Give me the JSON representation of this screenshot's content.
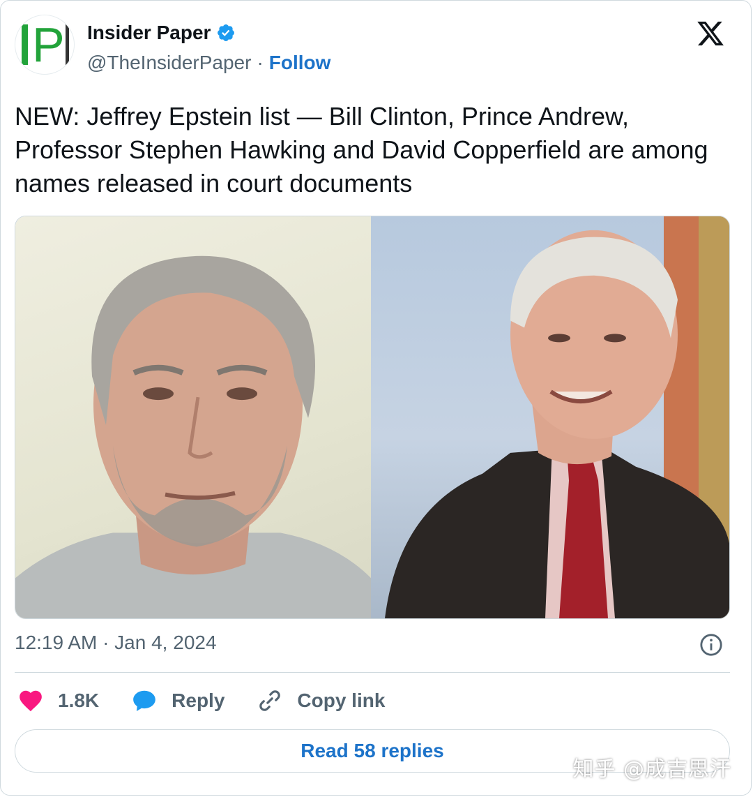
{
  "author": {
    "display_name": "Insider Paper",
    "handle": "@TheInsiderPaper",
    "separator": "·",
    "follow_label": "Follow",
    "avatar_text": "IP"
  },
  "tweet": {
    "text": "NEW: Jeffrey Epstein list — Bill Clinton, Prince Andrew, Professor Stephen Hawking and David Copperfield are among names released in court documents",
    "timestamp": "12:19 AM · Jan 4, 2024"
  },
  "actions": {
    "like_count": "1.8K",
    "reply_label": "Reply",
    "copy_link_label": "Copy link",
    "read_replies_label": "Read 58 replies"
  },
  "watermark": "知乎 @成吉思汗",
  "colors": {
    "accent": "#1d73c9",
    "verified": "#1d9bf0",
    "like": "#f91880",
    "text_secondary": "#536471",
    "border": "#cfd9de",
    "logo_green": "#22a33a"
  },
  "icons": {
    "verified": "verified-badge-icon",
    "platform": "x-logo-icon",
    "info": "info-icon",
    "like": "heart-icon",
    "reply": "speech-bubble-icon",
    "copy_link": "link-icon"
  }
}
